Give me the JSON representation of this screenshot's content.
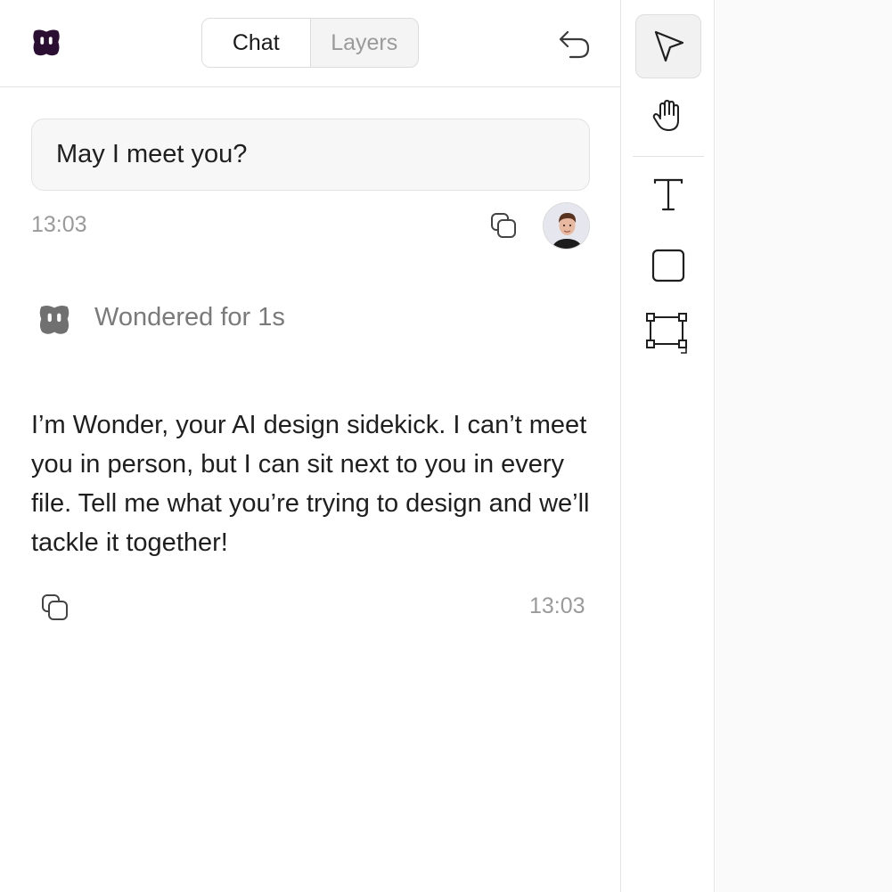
{
  "header": {
    "tabs": [
      {
        "label": "Chat",
        "active": true
      },
      {
        "label": "Layers",
        "active": false
      }
    ]
  },
  "messages": {
    "user": {
      "text": "May I meet you?",
      "time": "13:03"
    },
    "assistant": {
      "status": "Wondered for 1s",
      "text": "I’m Wonder, your AI design sidekick. I can’t meet you in person, but I can sit next to you in every file. Tell me what you’re trying to design and we’ll tackle it together!",
      "time": "13:03"
    }
  },
  "toolbar": {
    "tools": [
      "pointer-icon",
      "hand-icon",
      "text-icon",
      "rectangle-icon",
      "frame-icon"
    ],
    "selected": "pointer-icon"
  },
  "colors": {
    "brand": "#2b0f33",
    "muted_logo": "#707070",
    "canvas": "#fafafa"
  }
}
